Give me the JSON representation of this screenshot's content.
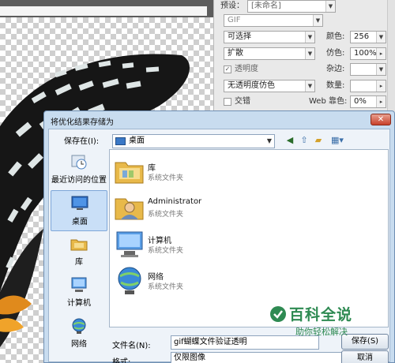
{
  "optimize_panel": {
    "preset_label": "预设：",
    "preset_value": "[未命名]",
    "format_value": "GIF",
    "palette_value": "可选择",
    "colors_label": "颜色:",
    "colors_value": "256",
    "dither_algo_value": "扩散",
    "dither_label": "仿色:",
    "dither_value": "100%",
    "transparency_label": "透明度",
    "matte_label": "杂边:",
    "transparency_dither_value": "无透明度仿色",
    "amount_label": "数量:",
    "interlaced_label": "交错",
    "web_snap_label": "Web 靠色:",
    "web_snap_value": "0%"
  },
  "dialog": {
    "title": "将优化结果存储为",
    "close_glyph": "✕",
    "save_in_label": "保存在(I):",
    "save_in_value": "桌面",
    "places": [
      {
        "label": "最近访问的位置"
      },
      {
        "label": "桌面"
      },
      {
        "label": "库"
      },
      {
        "label": "计算机"
      },
      {
        "label": "网络"
      }
    ],
    "items": [
      {
        "name": "库",
        "type": "系统文件夹"
      },
      {
        "name": "Administrator",
        "type": "系统文件夹"
      },
      {
        "name": "计算机",
        "type": "系统文件夹"
      },
      {
        "name": "网络",
        "type": "系统文件夹"
      }
    ],
    "filename_label": "文件名(N):",
    "filename_value": "gif蝴蝶文件验证透明",
    "filetype_label": "格式:",
    "filetype_value": "仅限图像",
    "save_button": "保存(S)",
    "cancel_button": "取消"
  },
  "watermark": {
    "main": "百科全说",
    "sub": "助你轻松解决"
  },
  "colors": {
    "accent": "#2e8a52",
    "dialog_frame": "#c8dcef",
    "close": "#c8402a"
  }
}
